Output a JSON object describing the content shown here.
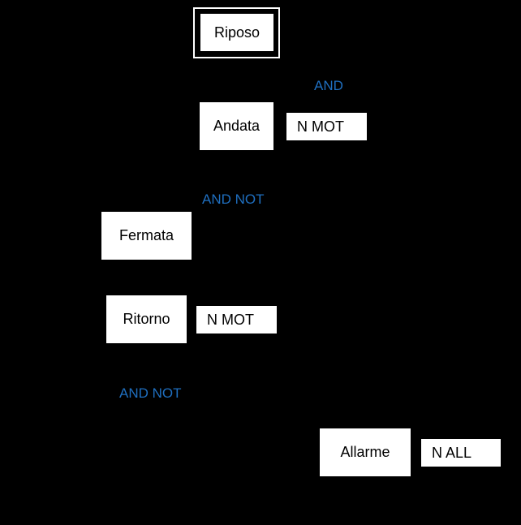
{
  "colors": {
    "background": "#000000",
    "box": "#ffffff",
    "condition": "#1f6fc0"
  },
  "steps": [
    {
      "label": "Riposo",
      "initial": true
    },
    {
      "label": "Andata",
      "action": "N MOT"
    },
    {
      "label": "Fermata"
    },
    {
      "label": "Ritorno",
      "action": "N MOT"
    },
    {
      "label": "Allarme",
      "action": "N ALL"
    }
  ],
  "conditions": [
    "AND",
    "AND NOT",
    "AND NOT"
  ]
}
